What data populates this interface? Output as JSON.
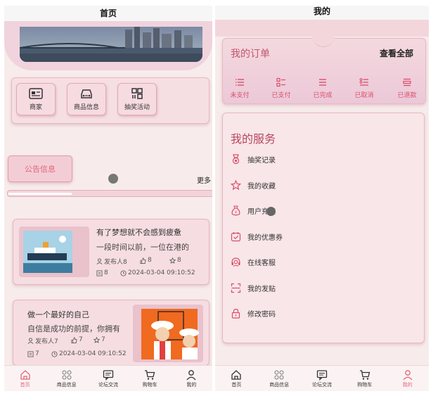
{
  "home": {
    "title": "首页",
    "quick": [
      {
        "label": "商家",
        "icon": "id-card-icon"
      },
      {
        "label": "商品信息",
        "icon": "car-icon"
      },
      {
        "label": "抽奖活动",
        "icon": "grid-icon"
      }
    ],
    "notice_label": "公告信息",
    "more_label": "更多",
    "posts": [
      {
        "title": "有了梦想就不会感到疲惫",
        "desc": "一段时间以前，一位在港的",
        "publisher": "发布人8",
        "likes": "8",
        "collects": "8",
        "comments": "8",
        "time": "2024-03-04 09:10:52"
      },
      {
        "title": "做一个最好的自己",
        "desc": "自信是成功的前提，你拥有",
        "publisher": "发布人7",
        "likes": "7",
        "collects": "7",
        "comments": "7",
        "time": "2024-03-04 09:10:52"
      }
    ]
  },
  "mine": {
    "title": "我的",
    "orders_title": "我的订单",
    "view_all": "查看全部",
    "orders": [
      {
        "label": "未支付",
        "icon": "list-icon"
      },
      {
        "label": "已支付",
        "icon": "checklist-icon"
      },
      {
        "label": "已完成",
        "icon": "lines-icon"
      },
      {
        "label": "已取消",
        "icon": "bullet-list-icon"
      },
      {
        "label": "已退款",
        "icon": "refund-icon"
      }
    ],
    "services_title": "我的服务",
    "services": [
      {
        "label": "抽奖记录",
        "icon": "medal-icon"
      },
      {
        "label": "我的收藏",
        "icon": "star-icon"
      },
      {
        "label": "用户充值",
        "icon": "money-bag-icon"
      },
      {
        "label": "我的优惠券",
        "icon": "coupon-icon"
      },
      {
        "label": "在线客服",
        "icon": "headset-icon"
      },
      {
        "label": "我的发贴",
        "icon": "scan-icon"
      },
      {
        "label": "修改密码",
        "icon": "lock-icon"
      }
    ]
  },
  "tabbar": [
    {
      "label": "首页",
      "icon": "home-icon"
    },
    {
      "label": "商品信息",
      "icon": "apps-icon"
    },
    {
      "label": "论坛交流",
      "icon": "chat-icon"
    },
    {
      "label": "购物车",
      "icon": "cart-icon"
    },
    {
      "label": "我的",
      "icon": "user-icon"
    }
  ],
  "colors": {
    "accent": "#e0667a",
    "card_bg": "#f6dfe3",
    "page_bg": "#f7eceb"
  }
}
